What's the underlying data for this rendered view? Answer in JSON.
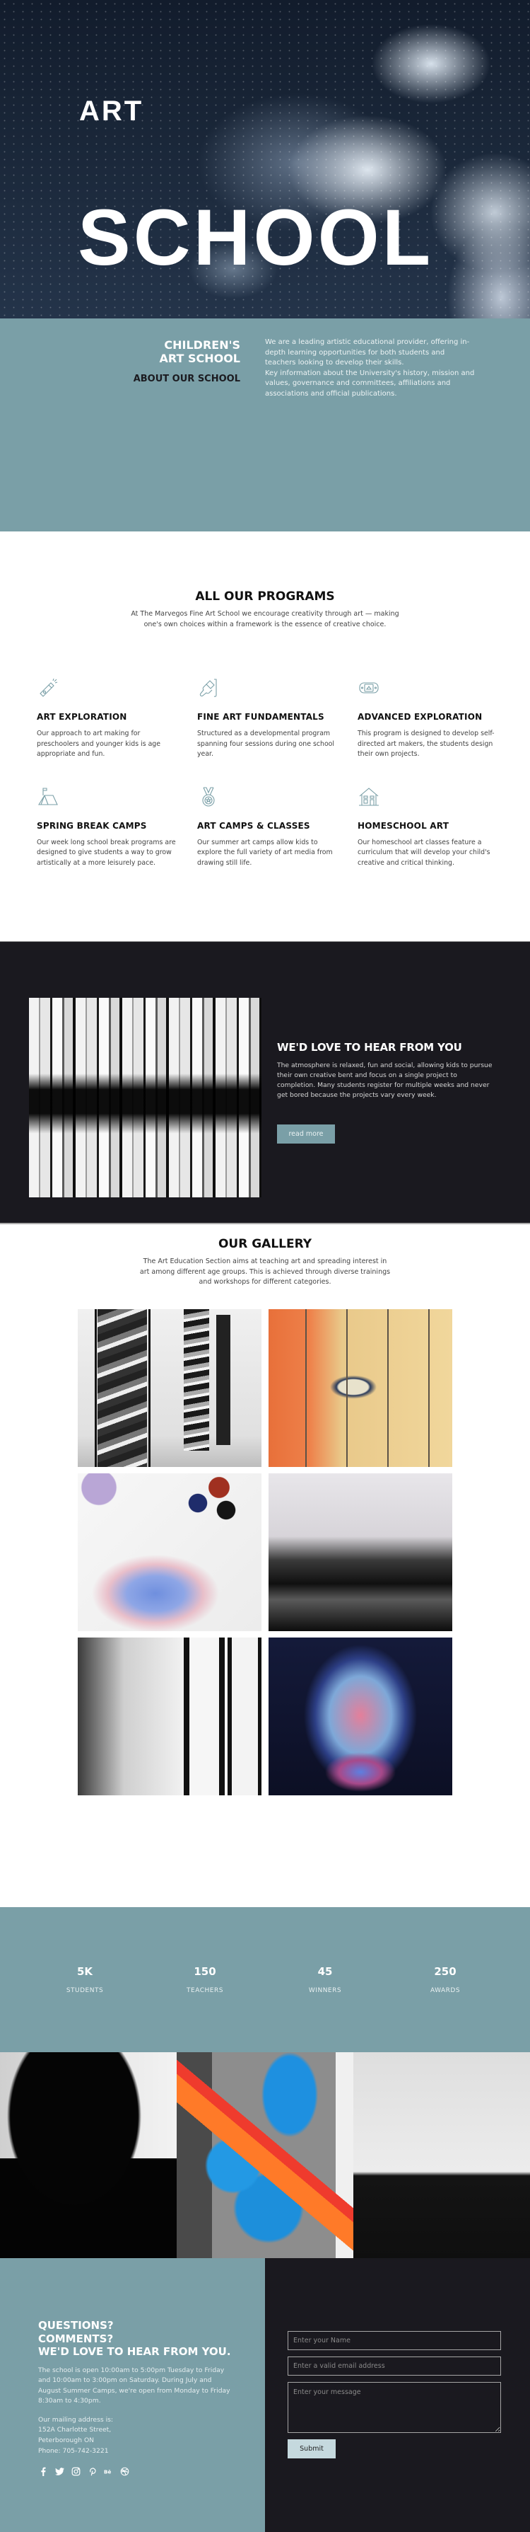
{
  "hero": {
    "title_small": "ART",
    "title_large": "SCHOOL"
  },
  "about": {
    "title_line1": "CHILDREN'S",
    "title_line2": "ART SCHOOL",
    "subtitle": "ABOUT OUR SCHOOL",
    "paragraph1": "We are a leading artistic educational provider, offering in-depth learning opportunities for both students and teachers looking to develop their skills.",
    "paragraph2": "Key information about the University's history, mission and values, governance and committees, affiliations and associations and official publications."
  },
  "programs": {
    "title": "ALL OUR PROGRAMS",
    "description": "At The Marvegos Fine Art School we encourage creativity through art — making one's own choices within a framework is the essence of creative choice.",
    "items": [
      {
        "icon": "flashlight-icon",
        "name": "ART EXPLORATION",
        "description": "Our approach to art making for preschoolers and younger kids is age appropriate and fun."
      },
      {
        "icon": "paint-brush-icon",
        "name": "FINE ART FUNDAMENTALS",
        "description": "Structured as a developmental program spanning four sessions during one school year."
      },
      {
        "icon": "game-console-icon",
        "name": "ADVANCED EXPLORATION",
        "description": "This program is designed to develop self-directed art makers, the students design their own projects."
      },
      {
        "icon": "tent-icon",
        "name": "SPRING BREAK CAMPS",
        "description": "Our week long school break programs are designed to give students a way to grow artistically at a more leisurely pace."
      },
      {
        "icon": "medal-icon",
        "name": "ART CAMPS & CLASSES",
        "description": "Our summer art camps allow kids to explore the full variety of art media from drawing still life."
      },
      {
        "icon": "house-icon",
        "name": "HOMESCHOOL ART",
        "description": "Our homeschool art classes feature a curriculum that will develop your child's creative and critical thinking."
      }
    ]
  },
  "teaser": {
    "title": "WE'D LOVE TO HEAR FROM YOU",
    "text": "The atmosphere is relaxed, fun and social, allowing kids to pursue their own creative bent and focus on a single project to completion. Many students register for multiple weeks and never get bored because the projects vary every week.",
    "button_label": "read more"
  },
  "gallery": {
    "title": "OUR GALLERY",
    "description": "The Art Education Section aims at teaching art and spreading interest in art among different age groups. This is achieved through diverse trainings and workshops for different categories.",
    "images": [
      "gallery-black-white-frames",
      "gallery-painted-eye-fence",
      "gallery-watercolor-palette",
      "gallery-abstract-black-white",
      "gallery-frames-hallway",
      "gallery-butterfly-face"
    ]
  },
  "stats": [
    {
      "value": "5K",
      "label": "STUDENTS"
    },
    {
      "value": "150",
      "label": "TEACHERS"
    },
    {
      "value": "45",
      "label": "WINNERS"
    },
    {
      "value": "250",
      "label": "AWARDS"
    }
  ],
  "footer": {
    "title_line1": "QUESTIONS?",
    "title_line2": "COMMENTS?",
    "title_line3": "WE'D LOVE TO HEAR FROM YOU.",
    "hours_text": "The school is open 10:00am to 5:00pm Tuesday to Friday and 10:00am to 3:00pm on Saturday. During July and August Summer Camps, we're open from Monday to Friday 8:30am to 4:30pm.",
    "address_label": "Our mailing address is:",
    "address_line1": "152A Charlotte Street,",
    "address_line2": "Peterborough ON",
    "phone": "Phone: 705-742-3221",
    "social": [
      "facebook-icon",
      "twitter-icon",
      "instagram-icon",
      "pinterest-icon",
      "behance-icon",
      "dribbble-icon"
    ],
    "form": {
      "name_placeholder": "Enter your Name",
      "email_placeholder": "Enter a valid email address",
      "message_placeholder": "Enter your message",
      "submit_label": "Submit"
    }
  },
  "colors": {
    "accent_teal": "#7a9fa7",
    "dark_bg": "#1a191f",
    "submit_bg": "#c5d9de"
  }
}
